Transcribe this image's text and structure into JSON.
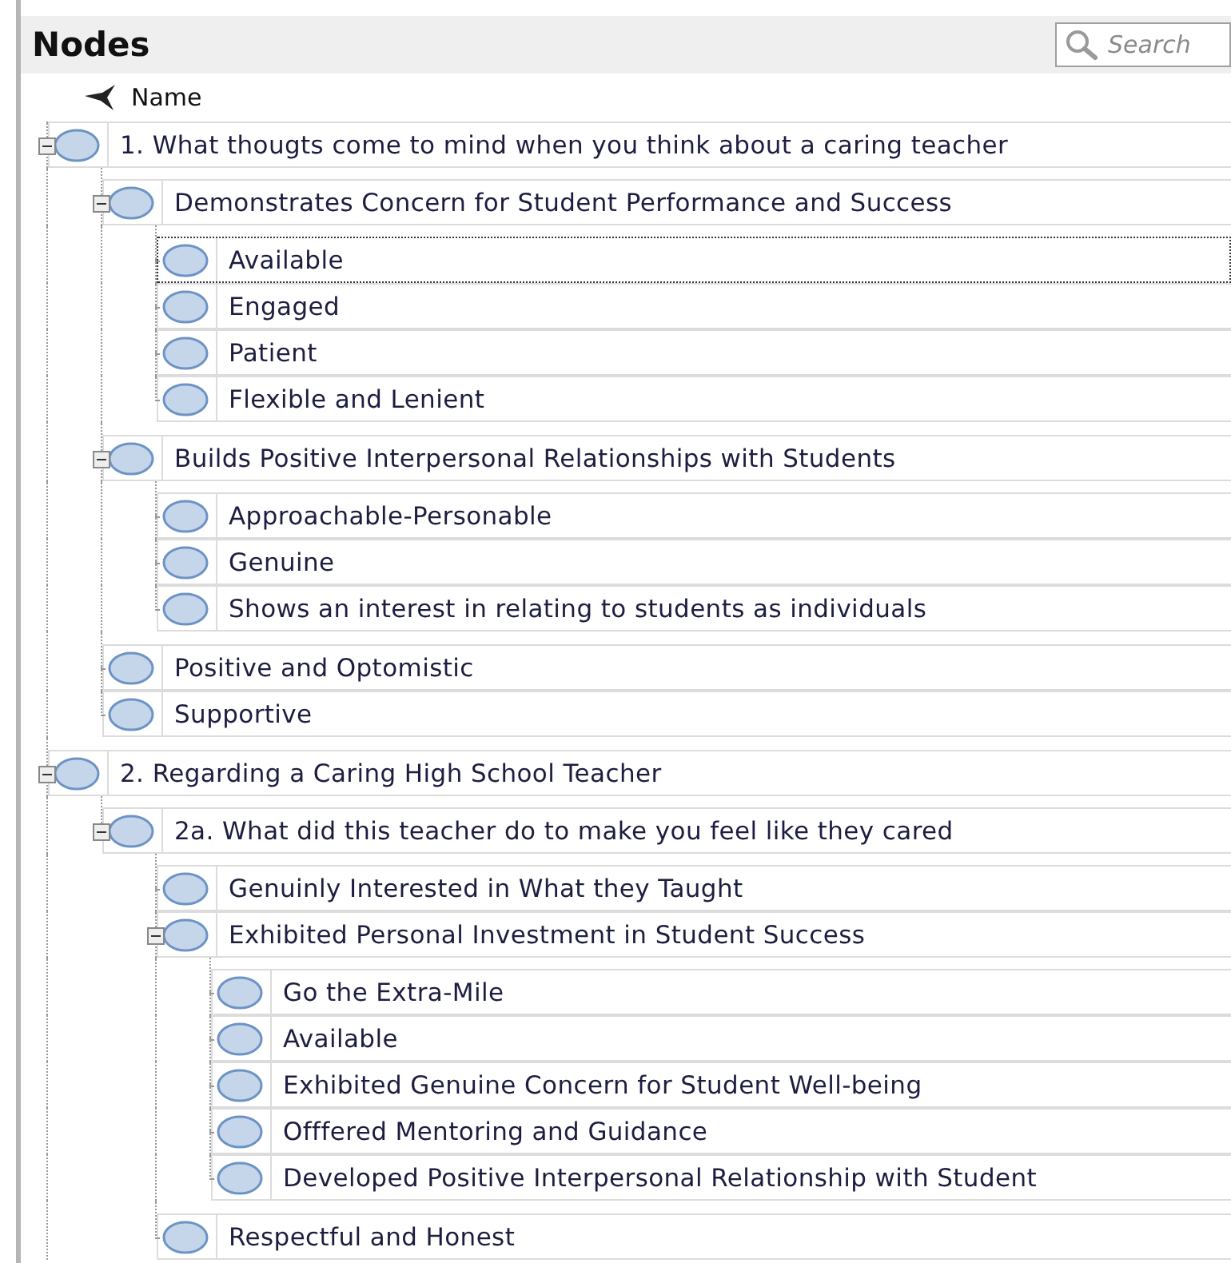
{
  "panel": {
    "title": "Nodes",
    "search": {
      "placeholder": "Search"
    }
  },
  "columns": [
    {
      "label": "Name"
    }
  ],
  "tree": [
    {
      "label": "1. What thougts come to mind when you think about a caring teacher",
      "selected": false,
      "expanded": true,
      "children": [
        {
          "label": "Demonstrates Concern for Student Performance and Success",
          "selected": false,
          "expanded": true,
          "children": [
            {
              "label": "Available",
              "selected": true
            },
            {
              "label": "Engaged",
              "selected": false
            },
            {
              "label": "Patient",
              "selected": false
            },
            {
              "label": "Flexible and Lenient",
              "selected": false
            }
          ]
        },
        {
          "label": "Builds Positive Interpersonal Relationships with Students",
          "selected": false,
          "expanded": true,
          "children": [
            {
              "label": "Approachable-Personable",
              "selected": false
            },
            {
              "label": "Genuine",
              "selected": false
            },
            {
              "label": "Shows an interest in relating to students as individuals",
              "selected": false
            }
          ]
        },
        {
          "label": "Positive and Optomistic",
          "selected": false
        },
        {
          "label": "Supportive",
          "selected": false
        }
      ]
    },
    {
      "label": "2. Regarding a Caring High School Teacher",
      "selected": false,
      "expanded": true,
      "children": [
        {
          "label": "2a. What did this teacher do to make you feel like they cared",
          "selected": false,
          "expanded": true,
          "children": [
            {
              "label": "Genuinly Interested in What they Taught",
              "selected": false
            },
            {
              "label": "Exhibited Personal Investment in Student Success",
              "selected": false,
              "expanded": true,
              "children": [
                {
                  "label": "Go the Extra-Mile",
                  "selected": false
                },
                {
                  "label": "Available",
                  "selected": false
                },
                {
                  "label": "Exhibited Genuine Concern for Student Well-being",
                  "selected": false
                },
                {
                  "label": "Offfered Mentoring and Guidance",
                  "selected": false
                },
                {
                  "label": "Developed Positive Interpersonal Relationship with Student",
                  "selected": false
                }
              ]
            },
            {
              "label": "Respectful and Honest",
              "selected": false
            }
          ]
        }
      ]
    }
  ]
}
